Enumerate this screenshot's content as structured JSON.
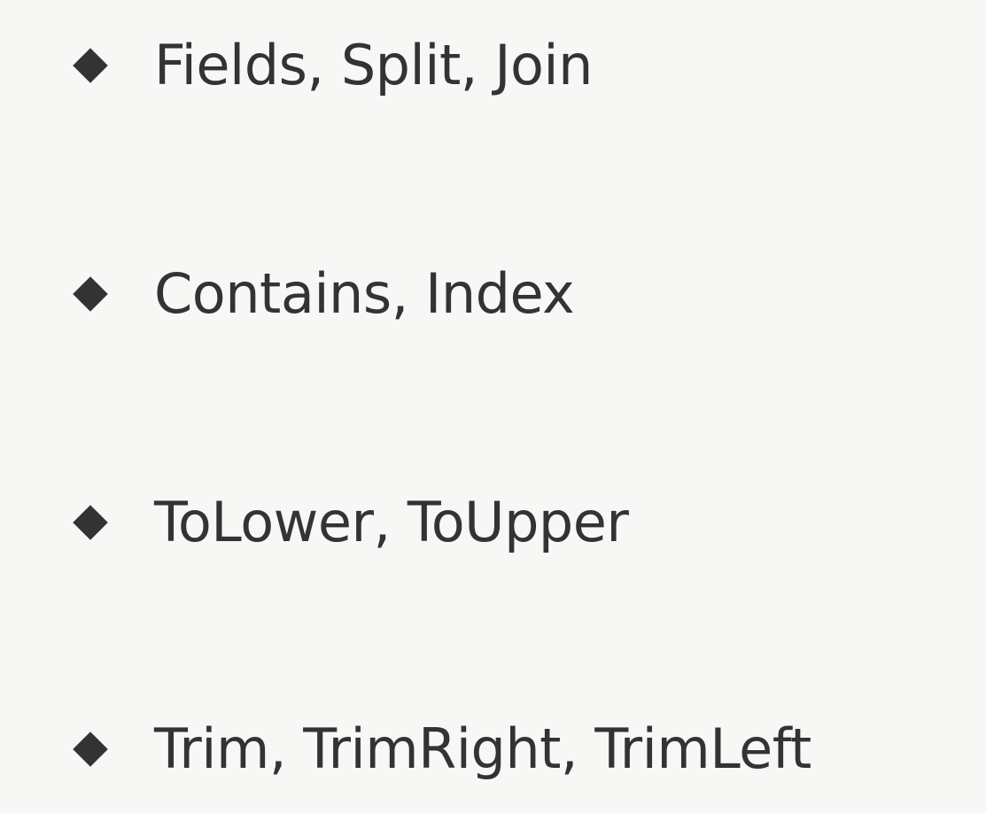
{
  "slide": {
    "items": [
      {
        "text": "Fields, Split, Join",
        "icon": "diamond-bullet-icon"
      },
      {
        "text": "Contains, Index",
        "icon": "diamond-bullet-icon"
      },
      {
        "text": "ToLower, ToUpper",
        "icon": "diamond-bullet-icon"
      },
      {
        "text": "Trim, TrimRight, TrimLeft",
        "icon": "diamond-bullet-icon"
      }
    ]
  },
  "colors": {
    "background": "#f7f7f5",
    "text": "#333333",
    "bullet": "#333333"
  }
}
